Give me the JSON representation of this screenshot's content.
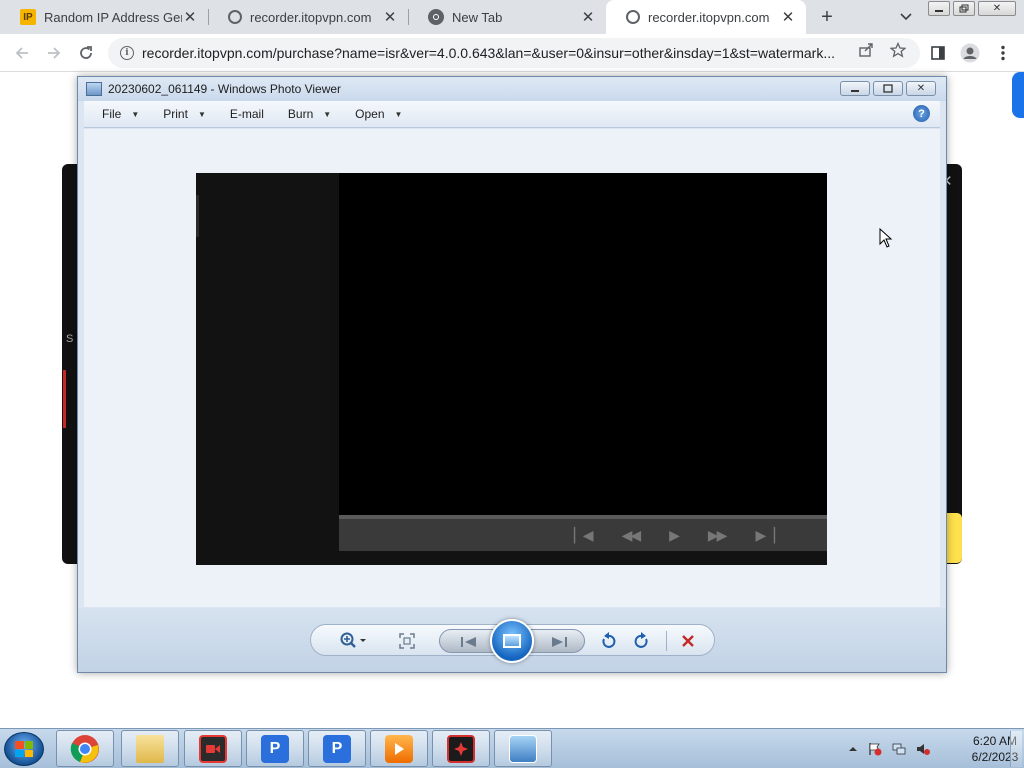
{
  "browser": {
    "tabs": [
      {
        "title": "Random IP Address Gene",
        "favicon": "ip-favicon"
      },
      {
        "title": "recorder.itopvpn.com",
        "favicon": "globe-icon"
      },
      {
        "title": "New Tab",
        "favicon": "chrome-icon"
      },
      {
        "title": "recorder.itopvpn.com",
        "favicon": "globe-icon",
        "active": true
      }
    ],
    "url": "recorder.itopvpn.com/purchase?name=isr&ver=4.0.0.643&lan=&user=0&insur=other&insday=1&st=watermark..."
  },
  "background_page": {
    "partial_text": "S"
  },
  "photo_viewer": {
    "title": "20230602_061149 - Windows Photo Viewer",
    "menus": [
      {
        "label": "File",
        "dropdown": true
      },
      {
        "label": "Print",
        "dropdown": true
      },
      {
        "label": "E-mail",
        "dropdown": false
      },
      {
        "label": "Burn",
        "dropdown": true
      },
      {
        "label": "Open",
        "dropdown": true
      }
    ],
    "help_label": "?",
    "toolbar": [
      "zoom-icon",
      "actual-size-icon",
      "previous-icon",
      "slideshow-icon",
      "next-icon",
      "rotate-counterclockwise-icon",
      "rotate-clockwise-icon",
      "delete-icon"
    ]
  },
  "taskbar": {
    "apps": [
      "chrome-icon",
      "file-explorer-icon",
      "screen-recorder-icon",
      "p-app-icon",
      "p-app-icon",
      "media-player-icon",
      "video-editor-icon",
      "photo-viewer-icon"
    ],
    "clock_time": "6:20 AM",
    "clock_date": "6/2/2023"
  },
  "colors": {
    "chrome_tabstrip": "#dee1e6",
    "photo_viewer_chrome": "#dbe6f2",
    "taskbar": "#b7cde3",
    "accent_blue": "#1a73e8"
  }
}
